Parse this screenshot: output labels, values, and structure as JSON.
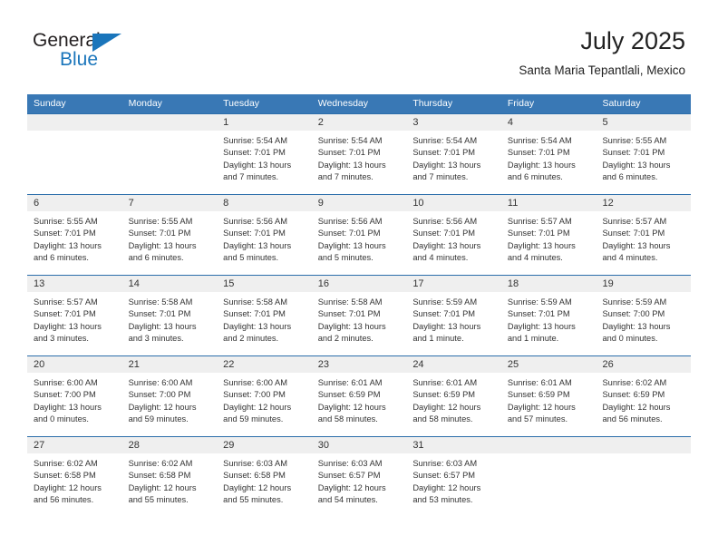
{
  "brand": {
    "name_part1": "General",
    "name_part2": "Blue",
    "triangle_color": "#1a75bb"
  },
  "header": {
    "month_title": "July 2025",
    "location": "Santa Maria Tepantlali, Mexico",
    "header_bg_color": "#3978b5",
    "row_divider_color": "#2c6eab",
    "day_band_color": "#efefef"
  },
  "weekday_headers": [
    "Sunday",
    "Monday",
    "Tuesday",
    "Wednesday",
    "Thursday",
    "Friday",
    "Saturday"
  ],
  "weeks": [
    [
      {
        "day": "",
        "sunrise": "",
        "sunset": "",
        "daylight_line1": "",
        "daylight_line2": ""
      },
      {
        "day": "",
        "sunrise": "",
        "sunset": "",
        "daylight_line1": "",
        "daylight_line2": ""
      },
      {
        "day": "1",
        "sunrise": "Sunrise: 5:54 AM",
        "sunset": "Sunset: 7:01 PM",
        "daylight_line1": "Daylight: 13 hours",
        "daylight_line2": "and 7 minutes."
      },
      {
        "day": "2",
        "sunrise": "Sunrise: 5:54 AM",
        "sunset": "Sunset: 7:01 PM",
        "daylight_line1": "Daylight: 13 hours",
        "daylight_line2": "and 7 minutes."
      },
      {
        "day": "3",
        "sunrise": "Sunrise: 5:54 AM",
        "sunset": "Sunset: 7:01 PM",
        "daylight_line1": "Daylight: 13 hours",
        "daylight_line2": "and 7 minutes."
      },
      {
        "day": "4",
        "sunrise": "Sunrise: 5:54 AM",
        "sunset": "Sunset: 7:01 PM",
        "daylight_line1": "Daylight: 13 hours",
        "daylight_line2": "and 6 minutes."
      },
      {
        "day": "5",
        "sunrise": "Sunrise: 5:55 AM",
        "sunset": "Sunset: 7:01 PM",
        "daylight_line1": "Daylight: 13 hours",
        "daylight_line2": "and 6 minutes."
      }
    ],
    [
      {
        "day": "6",
        "sunrise": "Sunrise: 5:55 AM",
        "sunset": "Sunset: 7:01 PM",
        "daylight_line1": "Daylight: 13 hours",
        "daylight_line2": "and 6 minutes."
      },
      {
        "day": "7",
        "sunrise": "Sunrise: 5:55 AM",
        "sunset": "Sunset: 7:01 PM",
        "daylight_line1": "Daylight: 13 hours",
        "daylight_line2": "and 6 minutes."
      },
      {
        "day": "8",
        "sunrise": "Sunrise: 5:56 AM",
        "sunset": "Sunset: 7:01 PM",
        "daylight_line1": "Daylight: 13 hours",
        "daylight_line2": "and 5 minutes."
      },
      {
        "day": "9",
        "sunrise": "Sunrise: 5:56 AM",
        "sunset": "Sunset: 7:01 PM",
        "daylight_line1": "Daylight: 13 hours",
        "daylight_line2": "and 5 minutes."
      },
      {
        "day": "10",
        "sunrise": "Sunrise: 5:56 AM",
        "sunset": "Sunset: 7:01 PM",
        "daylight_line1": "Daylight: 13 hours",
        "daylight_line2": "and 4 minutes."
      },
      {
        "day": "11",
        "sunrise": "Sunrise: 5:57 AM",
        "sunset": "Sunset: 7:01 PM",
        "daylight_line1": "Daylight: 13 hours",
        "daylight_line2": "and 4 minutes."
      },
      {
        "day": "12",
        "sunrise": "Sunrise: 5:57 AM",
        "sunset": "Sunset: 7:01 PM",
        "daylight_line1": "Daylight: 13 hours",
        "daylight_line2": "and 4 minutes."
      }
    ],
    [
      {
        "day": "13",
        "sunrise": "Sunrise: 5:57 AM",
        "sunset": "Sunset: 7:01 PM",
        "daylight_line1": "Daylight: 13 hours",
        "daylight_line2": "and 3 minutes."
      },
      {
        "day": "14",
        "sunrise": "Sunrise: 5:58 AM",
        "sunset": "Sunset: 7:01 PM",
        "daylight_line1": "Daylight: 13 hours",
        "daylight_line2": "and 3 minutes."
      },
      {
        "day": "15",
        "sunrise": "Sunrise: 5:58 AM",
        "sunset": "Sunset: 7:01 PM",
        "daylight_line1": "Daylight: 13 hours",
        "daylight_line2": "and 2 minutes."
      },
      {
        "day": "16",
        "sunrise": "Sunrise: 5:58 AM",
        "sunset": "Sunset: 7:01 PM",
        "daylight_line1": "Daylight: 13 hours",
        "daylight_line2": "and 2 minutes."
      },
      {
        "day": "17",
        "sunrise": "Sunrise: 5:59 AM",
        "sunset": "Sunset: 7:01 PM",
        "daylight_line1": "Daylight: 13 hours",
        "daylight_line2": "and 1 minute."
      },
      {
        "day": "18",
        "sunrise": "Sunrise: 5:59 AM",
        "sunset": "Sunset: 7:01 PM",
        "daylight_line1": "Daylight: 13 hours",
        "daylight_line2": "and 1 minute."
      },
      {
        "day": "19",
        "sunrise": "Sunrise: 5:59 AM",
        "sunset": "Sunset: 7:00 PM",
        "daylight_line1": "Daylight: 13 hours",
        "daylight_line2": "and 0 minutes."
      }
    ],
    [
      {
        "day": "20",
        "sunrise": "Sunrise: 6:00 AM",
        "sunset": "Sunset: 7:00 PM",
        "daylight_line1": "Daylight: 13 hours",
        "daylight_line2": "and 0 minutes."
      },
      {
        "day": "21",
        "sunrise": "Sunrise: 6:00 AM",
        "sunset": "Sunset: 7:00 PM",
        "daylight_line1": "Daylight: 12 hours",
        "daylight_line2": "and 59 minutes."
      },
      {
        "day": "22",
        "sunrise": "Sunrise: 6:00 AM",
        "sunset": "Sunset: 7:00 PM",
        "daylight_line1": "Daylight: 12 hours",
        "daylight_line2": "and 59 minutes."
      },
      {
        "day": "23",
        "sunrise": "Sunrise: 6:01 AM",
        "sunset": "Sunset: 6:59 PM",
        "daylight_line1": "Daylight: 12 hours",
        "daylight_line2": "and 58 minutes."
      },
      {
        "day": "24",
        "sunrise": "Sunrise: 6:01 AM",
        "sunset": "Sunset: 6:59 PM",
        "daylight_line1": "Daylight: 12 hours",
        "daylight_line2": "and 58 minutes."
      },
      {
        "day": "25",
        "sunrise": "Sunrise: 6:01 AM",
        "sunset": "Sunset: 6:59 PM",
        "daylight_line1": "Daylight: 12 hours",
        "daylight_line2": "and 57 minutes."
      },
      {
        "day": "26",
        "sunrise": "Sunrise: 6:02 AM",
        "sunset": "Sunset: 6:59 PM",
        "daylight_line1": "Daylight: 12 hours",
        "daylight_line2": "and 56 minutes."
      }
    ],
    [
      {
        "day": "27",
        "sunrise": "Sunrise: 6:02 AM",
        "sunset": "Sunset: 6:58 PM",
        "daylight_line1": "Daylight: 12 hours",
        "daylight_line2": "and 56 minutes."
      },
      {
        "day": "28",
        "sunrise": "Sunrise: 6:02 AM",
        "sunset": "Sunset: 6:58 PM",
        "daylight_line1": "Daylight: 12 hours",
        "daylight_line2": "and 55 minutes."
      },
      {
        "day": "29",
        "sunrise": "Sunrise: 6:03 AM",
        "sunset": "Sunset: 6:58 PM",
        "daylight_line1": "Daylight: 12 hours",
        "daylight_line2": "and 55 minutes."
      },
      {
        "day": "30",
        "sunrise": "Sunrise: 6:03 AM",
        "sunset": "Sunset: 6:57 PM",
        "daylight_line1": "Daylight: 12 hours",
        "daylight_line2": "and 54 minutes."
      },
      {
        "day": "31",
        "sunrise": "Sunrise: 6:03 AM",
        "sunset": "Sunset: 6:57 PM",
        "daylight_line1": "Daylight: 12 hours",
        "daylight_line2": "and 53 minutes."
      },
      {
        "day": "",
        "sunrise": "",
        "sunset": "",
        "daylight_line1": "",
        "daylight_line2": ""
      },
      {
        "day": "",
        "sunrise": "",
        "sunset": "",
        "daylight_line1": "",
        "daylight_line2": ""
      }
    ]
  ]
}
